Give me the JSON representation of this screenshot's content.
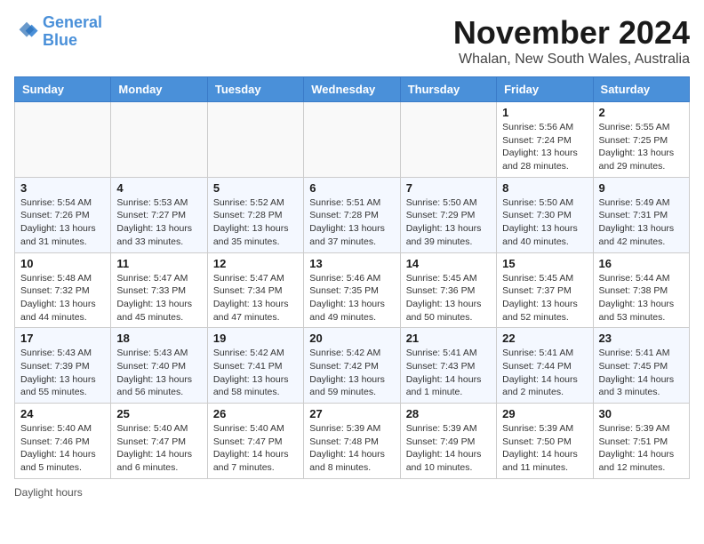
{
  "header": {
    "logo_line1": "General",
    "logo_line2": "Blue",
    "month_title": "November 2024",
    "location": "Whalan, New South Wales, Australia"
  },
  "weekdays": [
    "Sunday",
    "Monday",
    "Tuesday",
    "Wednesday",
    "Thursday",
    "Friday",
    "Saturday"
  ],
  "weeks": [
    [
      {
        "day": "",
        "info": ""
      },
      {
        "day": "",
        "info": ""
      },
      {
        "day": "",
        "info": ""
      },
      {
        "day": "",
        "info": ""
      },
      {
        "day": "",
        "info": ""
      },
      {
        "day": "1",
        "info": "Sunrise: 5:56 AM\nSunset: 7:24 PM\nDaylight: 13 hours and 28 minutes."
      },
      {
        "day": "2",
        "info": "Sunrise: 5:55 AM\nSunset: 7:25 PM\nDaylight: 13 hours and 29 minutes."
      }
    ],
    [
      {
        "day": "3",
        "info": "Sunrise: 5:54 AM\nSunset: 7:26 PM\nDaylight: 13 hours and 31 minutes."
      },
      {
        "day": "4",
        "info": "Sunrise: 5:53 AM\nSunset: 7:27 PM\nDaylight: 13 hours and 33 minutes."
      },
      {
        "day": "5",
        "info": "Sunrise: 5:52 AM\nSunset: 7:28 PM\nDaylight: 13 hours and 35 minutes."
      },
      {
        "day": "6",
        "info": "Sunrise: 5:51 AM\nSunset: 7:28 PM\nDaylight: 13 hours and 37 minutes."
      },
      {
        "day": "7",
        "info": "Sunrise: 5:50 AM\nSunset: 7:29 PM\nDaylight: 13 hours and 39 minutes."
      },
      {
        "day": "8",
        "info": "Sunrise: 5:50 AM\nSunset: 7:30 PM\nDaylight: 13 hours and 40 minutes."
      },
      {
        "day": "9",
        "info": "Sunrise: 5:49 AM\nSunset: 7:31 PM\nDaylight: 13 hours and 42 minutes."
      }
    ],
    [
      {
        "day": "10",
        "info": "Sunrise: 5:48 AM\nSunset: 7:32 PM\nDaylight: 13 hours and 44 minutes."
      },
      {
        "day": "11",
        "info": "Sunrise: 5:47 AM\nSunset: 7:33 PM\nDaylight: 13 hours and 45 minutes."
      },
      {
        "day": "12",
        "info": "Sunrise: 5:47 AM\nSunset: 7:34 PM\nDaylight: 13 hours and 47 minutes."
      },
      {
        "day": "13",
        "info": "Sunrise: 5:46 AM\nSunset: 7:35 PM\nDaylight: 13 hours and 49 minutes."
      },
      {
        "day": "14",
        "info": "Sunrise: 5:45 AM\nSunset: 7:36 PM\nDaylight: 13 hours and 50 minutes."
      },
      {
        "day": "15",
        "info": "Sunrise: 5:45 AM\nSunset: 7:37 PM\nDaylight: 13 hours and 52 minutes."
      },
      {
        "day": "16",
        "info": "Sunrise: 5:44 AM\nSunset: 7:38 PM\nDaylight: 13 hours and 53 minutes."
      }
    ],
    [
      {
        "day": "17",
        "info": "Sunrise: 5:43 AM\nSunset: 7:39 PM\nDaylight: 13 hours and 55 minutes."
      },
      {
        "day": "18",
        "info": "Sunrise: 5:43 AM\nSunset: 7:40 PM\nDaylight: 13 hours and 56 minutes."
      },
      {
        "day": "19",
        "info": "Sunrise: 5:42 AM\nSunset: 7:41 PM\nDaylight: 13 hours and 58 minutes."
      },
      {
        "day": "20",
        "info": "Sunrise: 5:42 AM\nSunset: 7:42 PM\nDaylight: 13 hours and 59 minutes."
      },
      {
        "day": "21",
        "info": "Sunrise: 5:41 AM\nSunset: 7:43 PM\nDaylight: 14 hours and 1 minute."
      },
      {
        "day": "22",
        "info": "Sunrise: 5:41 AM\nSunset: 7:44 PM\nDaylight: 14 hours and 2 minutes."
      },
      {
        "day": "23",
        "info": "Sunrise: 5:41 AM\nSunset: 7:45 PM\nDaylight: 14 hours and 3 minutes."
      }
    ],
    [
      {
        "day": "24",
        "info": "Sunrise: 5:40 AM\nSunset: 7:46 PM\nDaylight: 14 hours and 5 minutes."
      },
      {
        "day": "25",
        "info": "Sunrise: 5:40 AM\nSunset: 7:47 PM\nDaylight: 14 hours and 6 minutes."
      },
      {
        "day": "26",
        "info": "Sunrise: 5:40 AM\nSunset: 7:47 PM\nDaylight: 14 hours and 7 minutes."
      },
      {
        "day": "27",
        "info": "Sunrise: 5:39 AM\nSunset: 7:48 PM\nDaylight: 14 hours and 8 minutes."
      },
      {
        "day": "28",
        "info": "Sunrise: 5:39 AM\nSunset: 7:49 PM\nDaylight: 14 hours and 10 minutes."
      },
      {
        "day": "29",
        "info": "Sunrise: 5:39 AM\nSunset: 7:50 PM\nDaylight: 14 hours and 11 minutes."
      },
      {
        "day": "30",
        "info": "Sunrise: 5:39 AM\nSunset: 7:51 PM\nDaylight: 14 hours and 12 minutes."
      }
    ]
  ],
  "footer": {
    "daylight_label": "Daylight hours"
  }
}
